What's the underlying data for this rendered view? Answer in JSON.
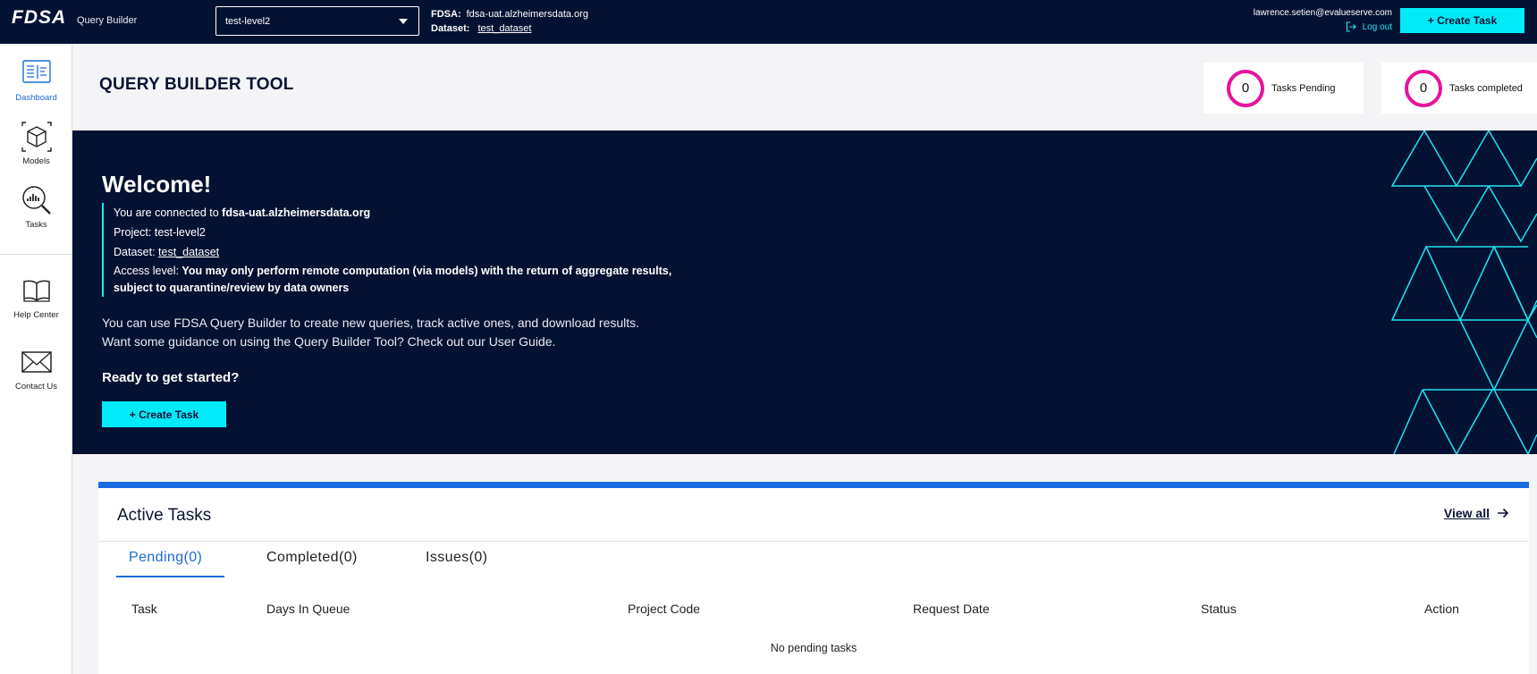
{
  "header": {
    "logo": "FDSA",
    "app_name": "Query Builder",
    "project_select": "test-level2",
    "fdsa_label": "FDSA:",
    "fdsa_host": "fdsa-uat.alzheimersdata.org",
    "dataset_label": "Dataset:",
    "dataset_name": "test_dataset",
    "user_email": "lawrence.setien@evalueserve.com",
    "logout_label": "Log out",
    "create_task_label": "+ Create Task"
  },
  "sidebar": {
    "items": [
      {
        "label": "Dashboard",
        "icon": "dashboard-icon"
      },
      {
        "label": "Models",
        "icon": "cube-icon"
      },
      {
        "label": "Tasks",
        "icon": "magnifier-chart-icon"
      },
      {
        "label": "Help Center",
        "icon": "book-icon"
      },
      {
        "label": "Contact Us",
        "icon": "envelope-icon"
      }
    ]
  },
  "page": {
    "title": "QUERY BUILDER TOOL",
    "stats": [
      {
        "value": "0",
        "label": "Tasks Pending"
      },
      {
        "value": "0",
        "label": "Tasks completed"
      }
    ]
  },
  "banner": {
    "welcome": "Welcome!",
    "connected_prefix": "You are connected to ",
    "connected_host": "fdsa-uat.alzheimersdata.org",
    "project_line": "Project: test-level2",
    "dataset_prefix": "Dataset: ",
    "dataset_link": "test_dataset",
    "access_prefix": "Access level: ",
    "access_text": "You may only perform remote computation (via models) with the return of aggregate results, subject to quarantine/review by data owners",
    "intro_line1": "You can use FDSA Query Builder to create new queries, track active ones, and download results.",
    "intro_line2": "Want some guidance on using the Query Builder Tool? Check out our User Guide.",
    "ready": "Ready to get started?",
    "create_task_label": "+ Create Task"
  },
  "tasks": {
    "title": "Active Tasks",
    "view_all": "View all",
    "tabs": [
      {
        "label": "Pending(0)",
        "active": true
      },
      {
        "label": "Completed(0)",
        "active": false
      },
      {
        "label": "Issues(0)",
        "active": false
      }
    ],
    "columns": [
      "Task",
      "Days In Queue",
      "Project Code",
      "Request Date",
      "Status",
      "Action"
    ],
    "empty_message": "No pending tasks"
  },
  "colors": {
    "navy": "#031233",
    "cyan": "#00eaf8",
    "magenta": "#e6139c",
    "blue": "#1a6ad6"
  }
}
